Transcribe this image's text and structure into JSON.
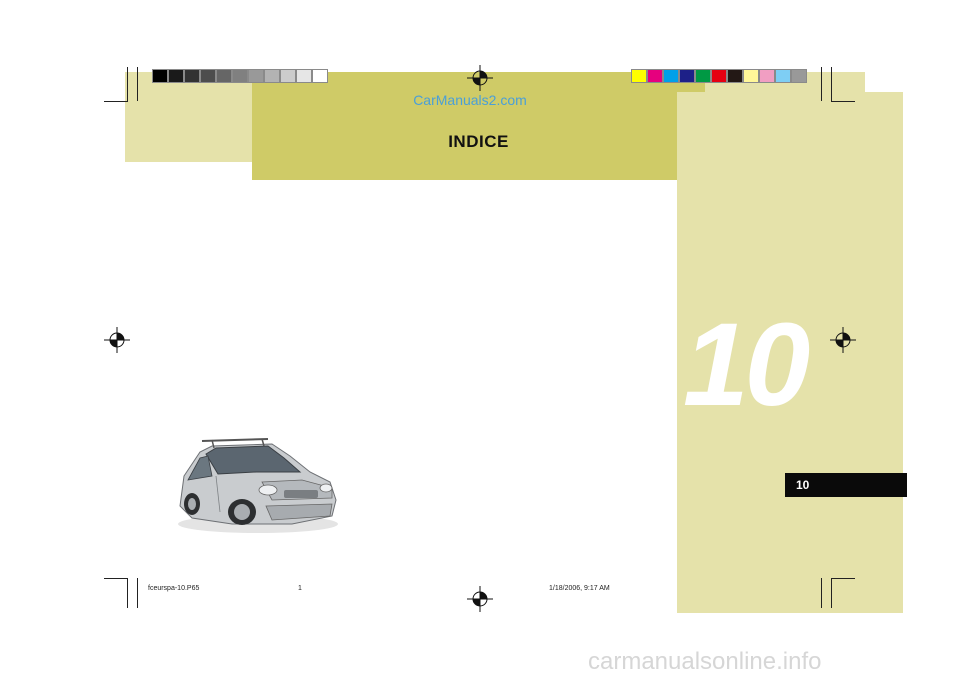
{
  "header": {
    "watermark": "CarManuals2.com",
    "title": "INDICE"
  },
  "section": {
    "number": "10",
    "tab_label": "10"
  },
  "footer": {
    "file": "fceurspa-10.P65",
    "page": "1",
    "timestamp": "1/18/2006, 9:17 AM"
  },
  "bottom_watermark": "carmanualsonline.info",
  "colors": {
    "grayscale_bar": [
      "#000000",
      "#1a1a1a",
      "#333333",
      "#4d4d4d",
      "#666666",
      "#808080",
      "#999999",
      "#b3b3b3",
      "#cccccc",
      "#e6e6e6",
      "#ffffff"
    ],
    "color_bar": [
      "#ffff00",
      "#e6007e",
      "#00a0e9",
      "#1d2088",
      "#009944",
      "#e60012",
      "#231815",
      "#fff799",
      "#f19ec2",
      "#7ecef4",
      "#999999"
    ],
    "panel_light": "#e5e2aa",
    "panel_title": "#cfcb67",
    "tab": "#0a0a0a"
  },
  "image": {
    "icon": "minivan-car-image"
  }
}
